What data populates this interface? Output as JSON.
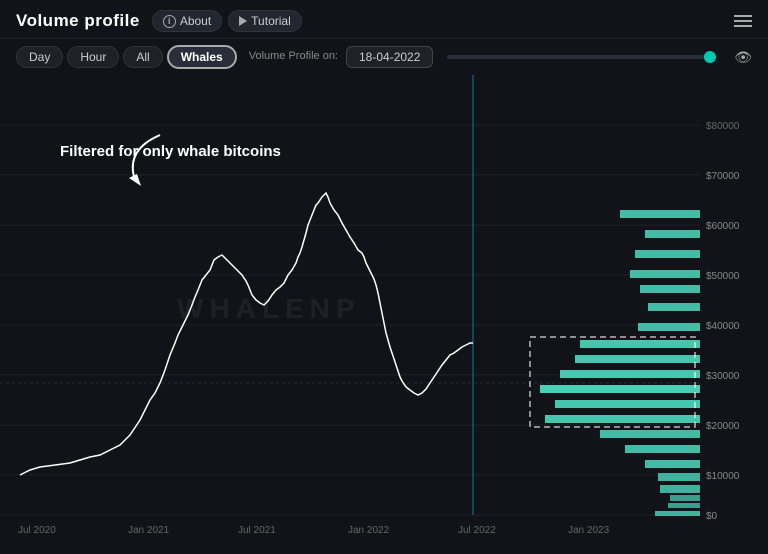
{
  "app": {
    "title": "Volume profile"
  },
  "header": {
    "about_label": "About",
    "tutorial_label": "Tutorial"
  },
  "toolbar": {
    "day_label": "Day",
    "hour_label": "Hour",
    "all_label": "All",
    "whales_label": "Whales",
    "volume_profile_label": "Volume Profile on:",
    "date_value": "18-04-2022"
  },
  "chart": {
    "watermark": "WHALENP",
    "annotation": "Filtered for only whale bitcoins",
    "x_labels": [
      "Jul 2020",
      "Jan 2021",
      "Jul 2021",
      "Jan 2022",
      "Jul 2022",
      "Jan 2023"
    ],
    "y_labels": [
      "$80000",
      "$70000",
      "$60000",
      "$50000",
      "$40000",
      "$30000",
      "$20000",
      "$10000",
      "$0"
    ]
  }
}
